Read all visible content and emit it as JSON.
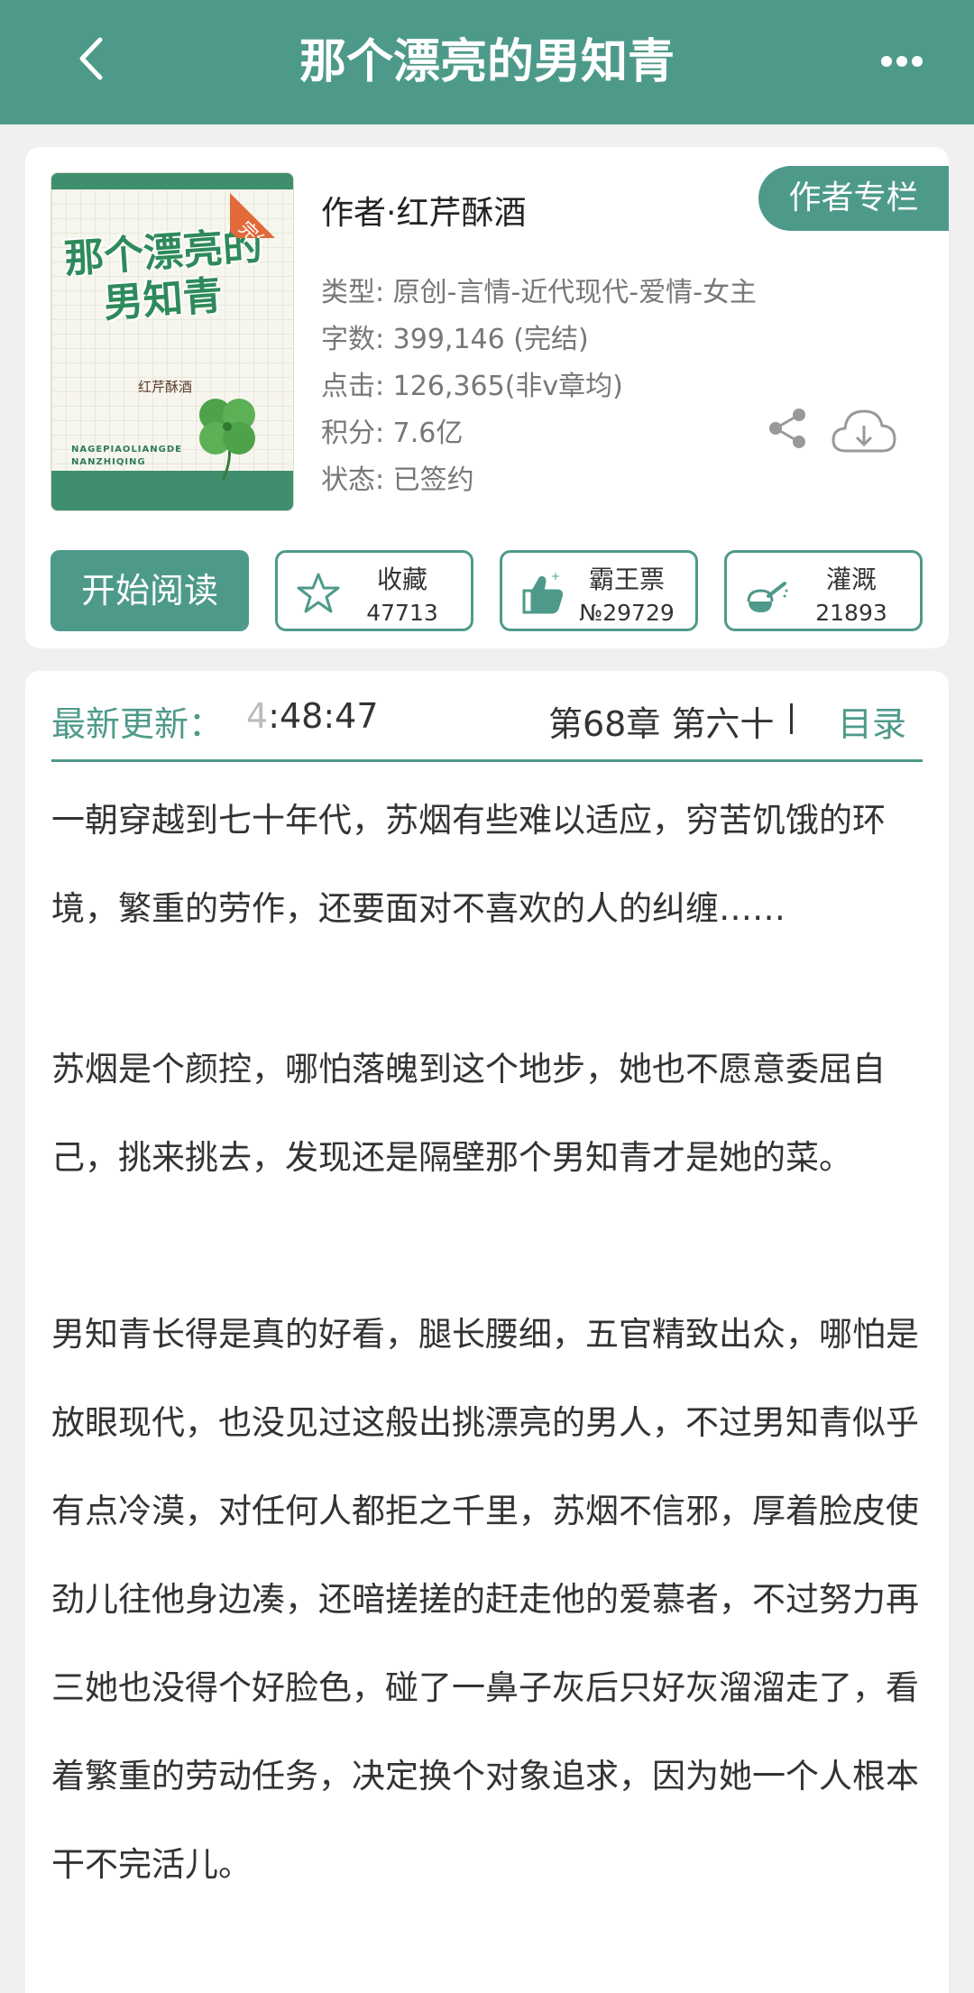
{
  "header": {
    "title": "那个漂亮的男知青",
    "back_icon": "chevron-left-icon",
    "more_icon": "more-dots-icon"
  },
  "book": {
    "cover": {
      "title_line1": "那个漂亮的",
      "title_line2": "男知青",
      "author": "红芹酥酒",
      "pinyin": "NAGEPIAOLIANGDE NANZHIQING",
      "badge": "完结"
    },
    "author_line": "作者·红芹酥酒",
    "author_column_button": "作者专栏",
    "meta": {
      "type": "类型: 原创-言情-近代现代-爱情-女主",
      "words": "字数: 399,146 (完结)",
      "clicks": "点击: 126,365(非v章均)",
      "score": "积分: 7.6亿",
      "status": "状态: 已签约"
    },
    "start_reading": "开始阅读",
    "actions": [
      {
        "label": "收藏",
        "count": "47713",
        "icon": "star-icon"
      },
      {
        "label": "霸王票",
        "count": "№29729",
        "icon": "thumbs-up-icon"
      },
      {
        "label": "灌溉",
        "count": "21893",
        "icon": "watering-can-icon"
      }
    ]
  },
  "update": {
    "label": "最新更新：",
    "time_faded": "4",
    "time": ":48:47",
    "chapter": "第68章  第六十",
    "toc": "目录"
  },
  "intro": {
    "p1": "一朝穿越到七十年代，苏烟有些难以适应，穷苦饥饿的环境，繁重的劳作，还要面对不喜欢的人的纠缠……",
    "p2": "苏烟是个颜控，哪怕落魄到这个地步，她也不愿意委屈自己，挑来挑去，发现还是隔壁那个男知青才是她的菜。",
    "p3": "男知青长得是真的好看，腿长腰细，五官精致出众，哪怕是放眼现代，也没见过这般出挑漂亮的男人，不过男知青似乎有点冷漠，对任何人都拒之千里，苏烟不信邪，厚着脸皮使劲儿往他身边凑，还暗搓搓的赶走他的爱慕者，不过努力再三她也没得个好脸色，碰了一鼻子灰后只好灰溜溜走了，看着繁重的劳动任务，决定换个对象追求，因为她一个人根本干不完活儿。"
  },
  "colors": {
    "accent": "#4e9a8a",
    "badge": "#e06a3a"
  }
}
